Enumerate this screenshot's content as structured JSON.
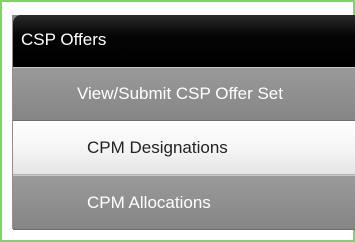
{
  "menu": {
    "title": "CSP Offers",
    "items": [
      {
        "label": "View/Submit CSP Offer Set"
      },
      {
        "label": "CPM Designations"
      },
      {
        "label": "CPM Allocations"
      }
    ]
  }
}
